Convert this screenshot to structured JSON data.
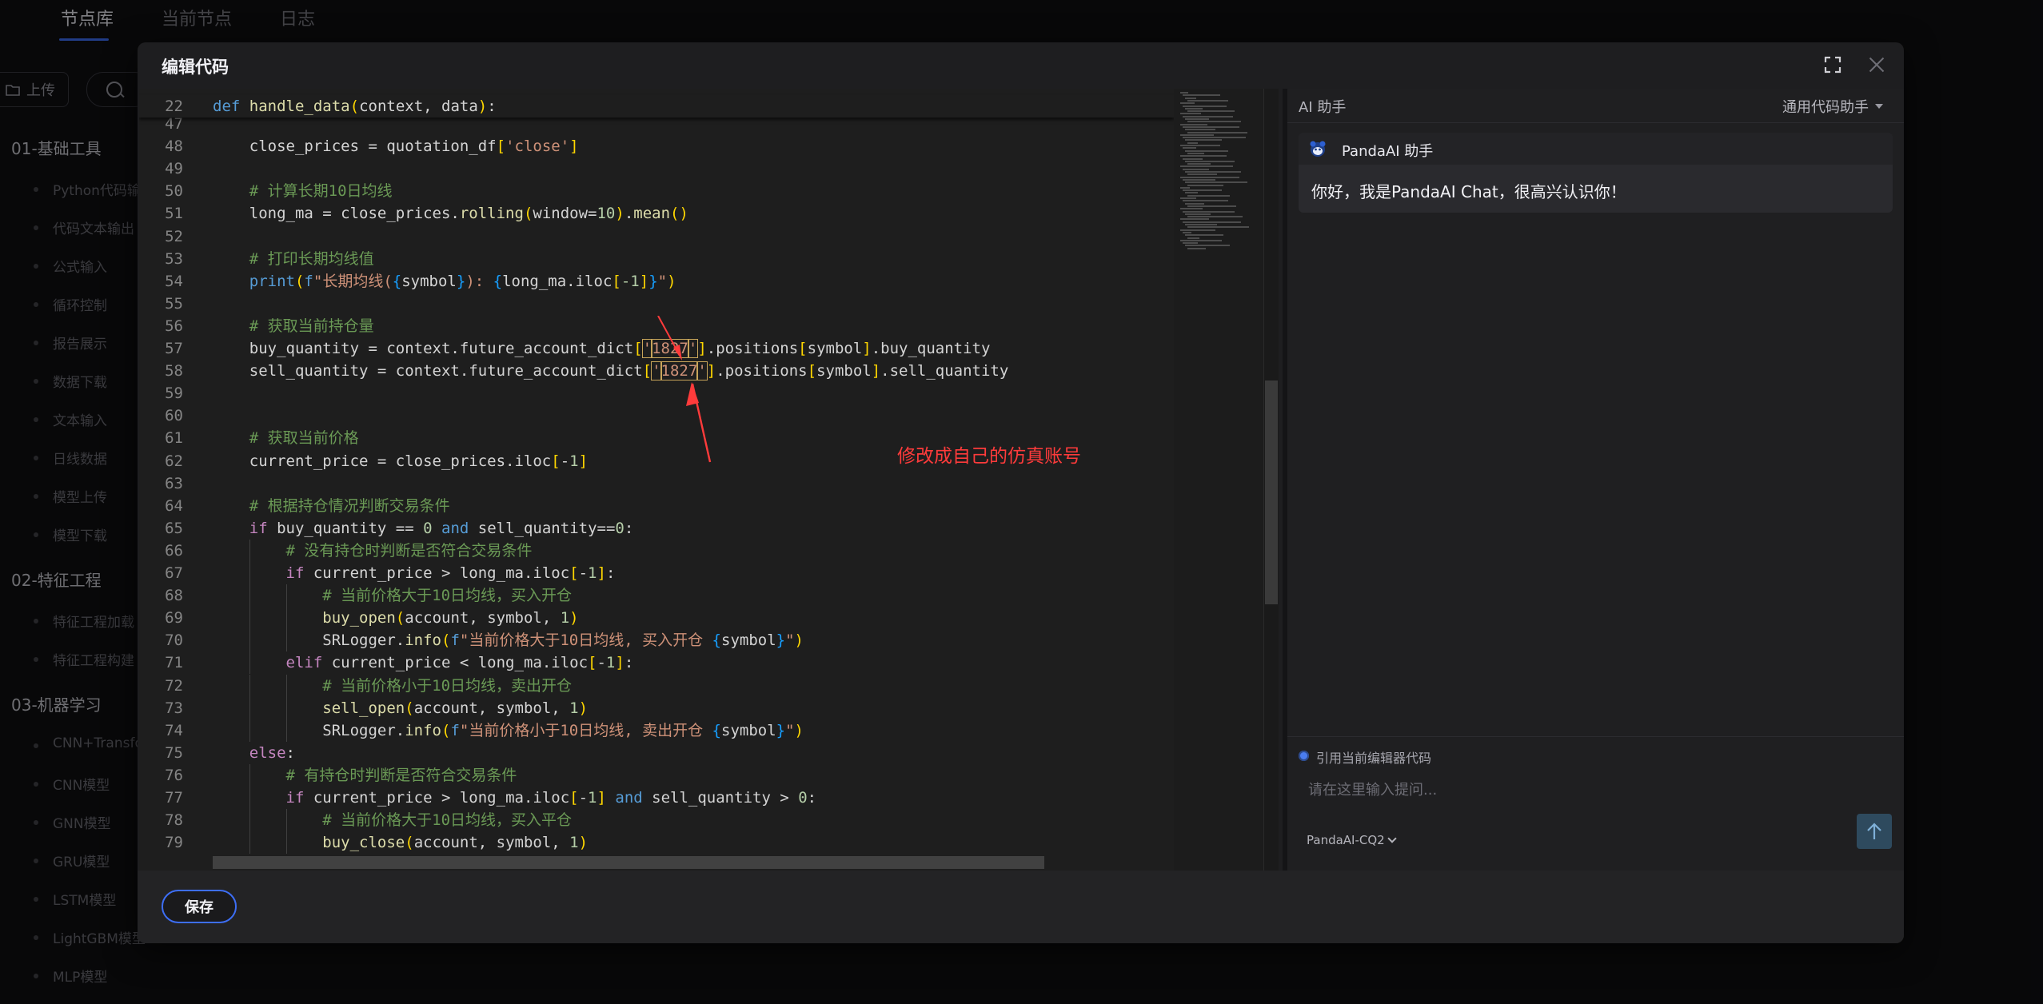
{
  "background": {
    "tabs": [
      {
        "label": "节点库",
        "active": true
      },
      {
        "label": "当前节点",
        "active": false
      },
      {
        "label": "日志",
        "active": false
      }
    ],
    "upload_label": "上传",
    "tree": [
      {
        "type": "cat",
        "label": "01-基础工具"
      },
      {
        "type": "item",
        "label": "Python代码输"
      },
      {
        "type": "item",
        "label": "代码文本输出"
      },
      {
        "type": "item",
        "label": "公式输入"
      },
      {
        "type": "item",
        "label": "循环控制"
      },
      {
        "type": "item",
        "label": "报告展示"
      },
      {
        "type": "item",
        "label": "数据下载"
      },
      {
        "type": "item",
        "label": "文本输入"
      },
      {
        "type": "item",
        "label": "日线数据"
      },
      {
        "type": "item",
        "label": "模型上传"
      },
      {
        "type": "item",
        "label": "模型下载"
      },
      {
        "type": "cat",
        "label": "02-特征工程"
      },
      {
        "type": "item",
        "label": "特征工程加载"
      },
      {
        "type": "item",
        "label": "特征工程构建"
      },
      {
        "type": "cat",
        "label": "03-机器学习"
      },
      {
        "type": "item",
        "label": "CNN+Transfo"
      },
      {
        "type": "item",
        "label": "CNN模型"
      },
      {
        "type": "item",
        "label": "GNN模型"
      },
      {
        "type": "item",
        "label": "GRU模型"
      },
      {
        "type": "item",
        "label": "LSTM模型"
      },
      {
        "type": "item",
        "label": "LightGBM模型"
      },
      {
        "type": "item",
        "label": "MLP模型"
      }
    ]
  },
  "modal": {
    "title": "编辑代码",
    "save_label": "保存"
  },
  "editor": {
    "sticky_line": {
      "n": "22",
      "code": "def handle_data(context, data):"
    },
    "lines": [
      {
        "n": "47",
        "code": ""
      },
      {
        "n": "48",
        "code": "    close_prices = quotation_df['close']"
      },
      {
        "n": "49",
        "code": ""
      },
      {
        "n": "50",
        "code": "    # 计算长期10日均线"
      },
      {
        "n": "51",
        "code": "    long_ma = close_prices.rolling(window=10).mean()"
      },
      {
        "n": "52",
        "code": ""
      },
      {
        "n": "53",
        "code": "    # 打印长期均线值"
      },
      {
        "n": "54",
        "code": "    print(f\"长期均线({symbol}): {long_ma.iloc[-1]}\")"
      },
      {
        "n": "55",
        "code": ""
      },
      {
        "n": "56",
        "code": "    # 获取当前持仓量"
      },
      {
        "n": "57",
        "code": "    buy_quantity = context.future_account_dict['1827'].positions[symbol].buy_quantity"
      },
      {
        "n": "58",
        "code": "    sell_quantity = context.future_account_dict['1827'].positions[symbol].sell_quantity"
      },
      {
        "n": "59",
        "code": ""
      },
      {
        "n": "60",
        "code": ""
      },
      {
        "n": "61",
        "code": "    # 获取当前价格"
      },
      {
        "n": "62",
        "code": "    current_price = close_prices.iloc[-1]"
      },
      {
        "n": "63",
        "code": ""
      },
      {
        "n": "64",
        "code": "    # 根据持仓情况判断交易条件"
      },
      {
        "n": "65",
        "code": "    if buy_quantity == 0 and sell_quantity==0:"
      },
      {
        "n": "66",
        "code": "        # 没有持仓时判断是否符合交易条件"
      },
      {
        "n": "67",
        "code": "        if current_price > long_ma.iloc[-1]:"
      },
      {
        "n": "68",
        "code": "            # 当前价格大于10日均线，买入开仓"
      },
      {
        "n": "69",
        "code": "            buy_open(account, symbol, 1)"
      },
      {
        "n": "70",
        "code": "            SRLogger.info(f\"当前价格大于10日均线, 买入开仓 {symbol}\")"
      },
      {
        "n": "71",
        "code": "        elif current_price < long_ma.iloc[-1]:"
      },
      {
        "n": "72",
        "code": "            # 当前价格小于10日均线，卖出开仓"
      },
      {
        "n": "73",
        "code": "            sell_open(account, symbol, 1)"
      },
      {
        "n": "74",
        "code": "            SRLogger.info(f\"当前价格小于10日均线, 卖出开仓 {symbol}\")"
      },
      {
        "n": "75",
        "code": "    else:"
      },
      {
        "n": "76",
        "code": "        # 有持仓时判断是否符合交易条件"
      },
      {
        "n": "77",
        "code": "        if current_price > long_ma.iloc[-1] and sell_quantity > 0:"
      },
      {
        "n": "78",
        "code": "            # 当前价格大于10日均线，买入平仓"
      },
      {
        "n": "79",
        "code": "            buy_close(account, symbol, 1)"
      }
    ]
  },
  "annotation": {
    "text": "修改成自己的仿真账号"
  },
  "ai": {
    "title": "AI 助手",
    "mode": "通用代码助手",
    "bot_name": "PandaAI 助手",
    "greeting": "你好，我是PandaAI Chat，很高兴认识你！",
    "ref_label": "引用当前编辑器代码",
    "input_placeholder": "请在这里输入提问...",
    "model": "PandaAI-CQ2"
  },
  "colors": {
    "accent": "#3d6ef5",
    "annotation": "#ff3b3b"
  }
}
